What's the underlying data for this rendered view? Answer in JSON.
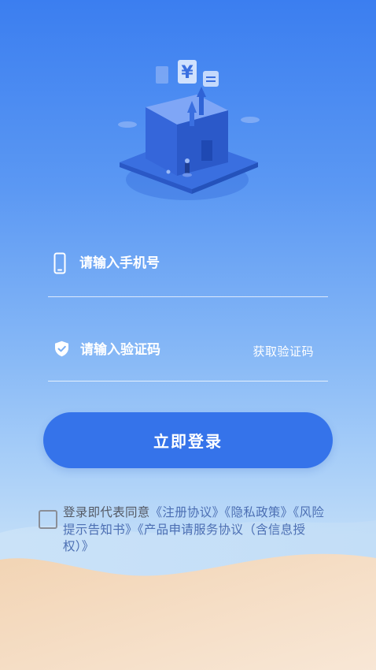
{
  "form": {
    "phone_placeholder": "请输入手机号",
    "code_placeholder": "请输入验证码",
    "get_code_label": "获取验证码",
    "login_label": "立即登录"
  },
  "agreement": {
    "prefix": "登录即代表同意",
    "links": [
      "《注册协议》",
      "《隐私政策》",
      "《风险提示告知书》",
      "《产品申请服务协议（含信息授权）》"
    ]
  },
  "icons": {
    "phone": "phone-icon",
    "shield": "shield-check-icon",
    "illustration": "building-finance-illustration"
  },
  "colors": {
    "accent": "#3573ea",
    "bg_top": "#3b7ef0",
    "bg_bottom": "#bfdcf8",
    "text_light": "#ffffff",
    "agreement_text": "#545964",
    "agreement_link": "#4c6fb3"
  }
}
